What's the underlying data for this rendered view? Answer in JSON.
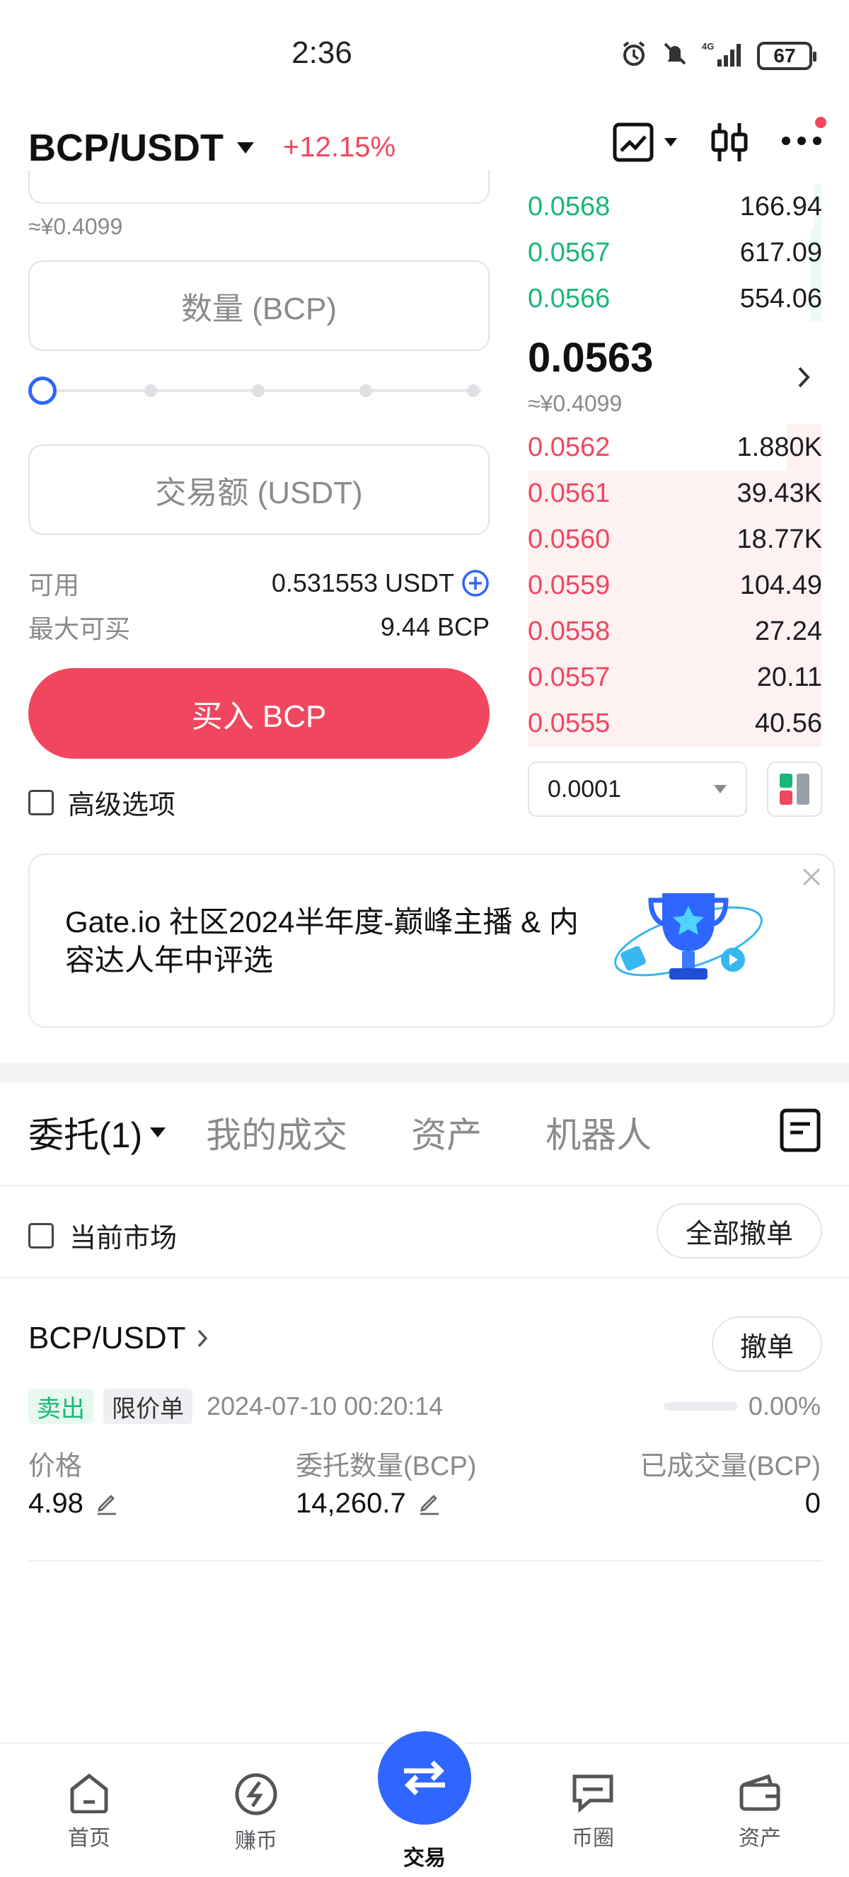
{
  "status_bar": {
    "time": "2:36",
    "battery": "67"
  },
  "header": {
    "pair": "BCP/USDT",
    "change": "+12.15%"
  },
  "trade": {
    "price_cny": "≈¥0.4099",
    "amount_placeholder": "数量 (BCP)",
    "total_placeholder": "交易额 (USDT)",
    "available_label": "可用",
    "available_value": "0.531553 USDT",
    "max_buy_label": "最大可买",
    "max_buy_value": "9.44 BCP",
    "buy_label": "买入 BCP",
    "advanced_label": "高级选项",
    "slider_percent": 0
  },
  "orderbook": {
    "asks": [
      {
        "price": "0.0568",
        "qty": "166.94",
        "depth": 0.03
      },
      {
        "price": "0.0567",
        "qty": "617.09",
        "depth": 0.04
      },
      {
        "price": "0.0566",
        "qty": "554.06",
        "depth": 0.04
      }
    ],
    "mid_price": "0.0563",
    "mid_cny": "≈¥0.4099",
    "bids": [
      {
        "price": "0.0562",
        "qty": "1.880K",
        "depth": 0.12
      },
      {
        "price": "0.0561",
        "qty": "39.43K",
        "depth": 1.0
      },
      {
        "price": "0.0560",
        "qty": "18.77K",
        "depth": 1.0
      },
      {
        "price": "0.0559",
        "qty": "104.49",
        "depth": 1.0
      },
      {
        "price": "0.0558",
        "qty": "27.24",
        "depth": 1.0
      },
      {
        "price": "0.0557",
        "qty": "20.11",
        "depth": 1.0
      },
      {
        "price": "0.0555",
        "qty": "40.56",
        "depth": 1.0
      }
    ],
    "precision": "0.0001"
  },
  "banner": {
    "text": "Gate.io 社区2024半年度-巅峰主播 & 内容达人年中评选"
  },
  "tabs": {
    "orders": "委托(1)",
    "trades": "我的成交",
    "assets": "资产",
    "bots": "机器人"
  },
  "filters": {
    "current_market": "当前市场",
    "cancel_all": "全部撤单"
  },
  "order": {
    "pair": "BCP/USDT",
    "cancel": "撤单",
    "side": "卖出",
    "type": "限价单",
    "time": "2024-07-10 00:20:14",
    "filled_percent": "0.00%",
    "price_label": "价格",
    "price_value": "4.98",
    "qty_label": "委托数量(BCP)",
    "qty_value": "14,260.7",
    "filled_label": "已成交量(BCP)",
    "filled_value": "0"
  },
  "nav": {
    "home": "首页",
    "earn": "赚币",
    "trade": "交易",
    "social": "币圈",
    "assets": "资产"
  },
  "colors": {
    "accent": "#2e66ff",
    "sell": "#f0475f",
    "buy": "#19b777"
  }
}
